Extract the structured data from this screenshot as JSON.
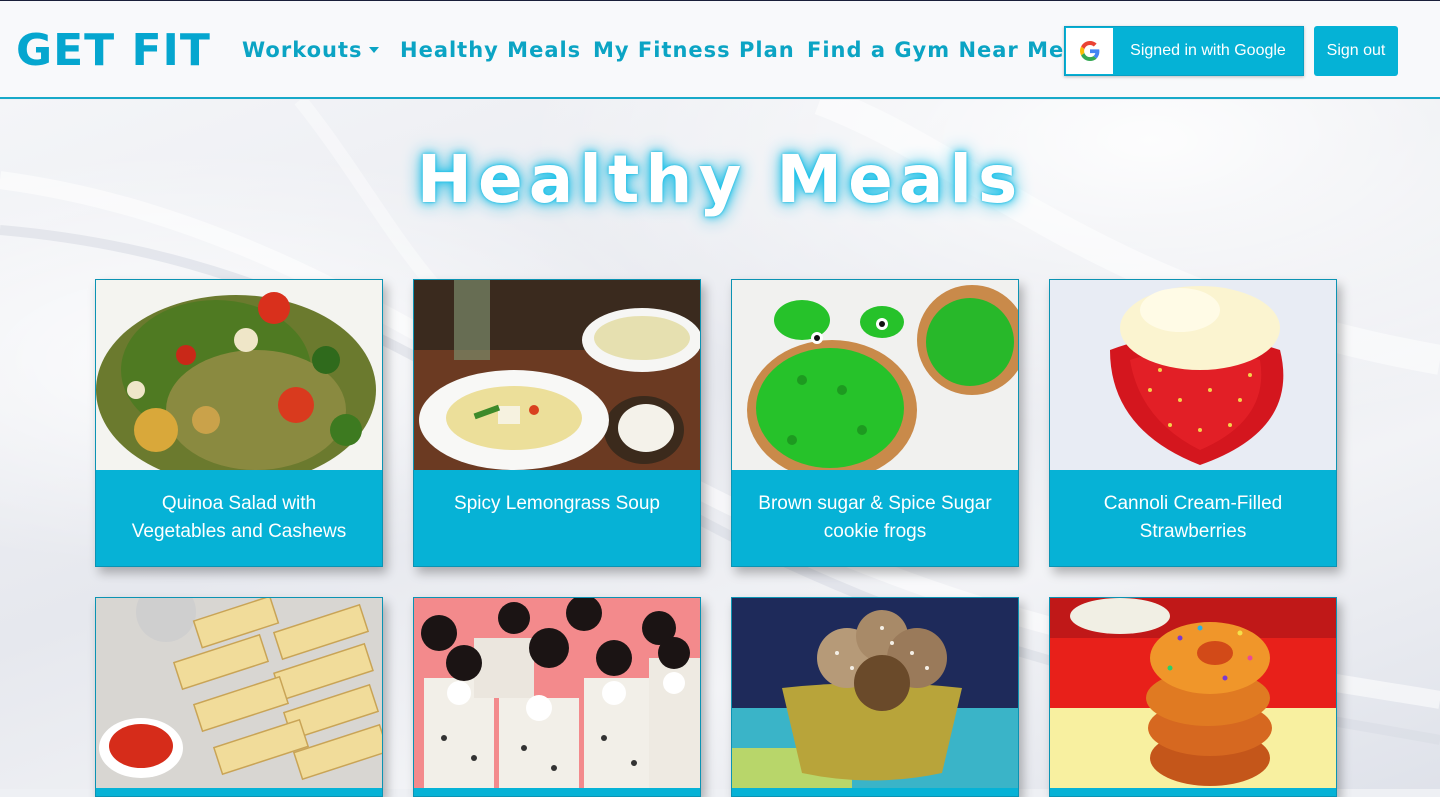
{
  "navbar": {
    "brand": "GET FIT",
    "links": [
      {
        "label": "Workouts",
        "dropdown": true
      },
      {
        "label": "Healthy Meals"
      },
      {
        "label": "My Fitness Plan"
      },
      {
        "label": "Find a Gym Near Me"
      }
    ],
    "google_button_label": "Signed in with Google",
    "signout_label": "Sign out"
  },
  "page": {
    "title": "Healthy Meals"
  },
  "meals": [
    {
      "title": "Quinoa Salad with Vegetables and Cashews",
      "image": "quinoa-salad"
    },
    {
      "title": "Spicy Lemongrass Soup",
      "image": "lemongrass-soup"
    },
    {
      "title": "Brown sugar & Spice Sugar cookie frogs",
      "image": "frog-cookies"
    },
    {
      "title": "Cannoli Cream-Filled Strawberries",
      "image": "cannoli-strawberries"
    },
    {
      "title": "",
      "image": "cauliflower-breadsticks"
    },
    {
      "title": "",
      "image": "oreo-cheesecakes"
    },
    {
      "title": "",
      "image": "energy-balls"
    },
    {
      "title": "",
      "image": "glazed-donuts"
    }
  ],
  "colors": {
    "accent": "#05b2d6",
    "brand": "#05a6cf",
    "nav_link": "#0ba4c4"
  }
}
